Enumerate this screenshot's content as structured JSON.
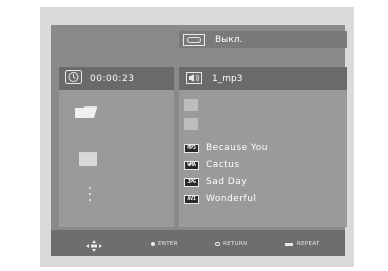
{
  "status": {
    "repeat_mode": "Выкл."
  },
  "left": {
    "time": "00:00:23"
  },
  "right": {
    "current_file": "1_mp3",
    "files": [
      {
        "type": "MP3",
        "name": "Because You"
      },
      {
        "type": "WMA",
        "name": "Cactus"
      },
      {
        "type": "JPG",
        "name": "Sad Day"
      },
      {
        "type": "AVI",
        "name": "Wonderful"
      }
    ]
  },
  "footer": {
    "enter_label": "ENTER",
    "return_label": "RETURN",
    "repeat_label": "REPEAT"
  },
  "icons": {
    "repeat": "repeat-icon",
    "clock": "clock-icon",
    "file": "speaker-file-icon",
    "folder": "folder-icon",
    "nav": "navigation-arrows-icon"
  }
}
